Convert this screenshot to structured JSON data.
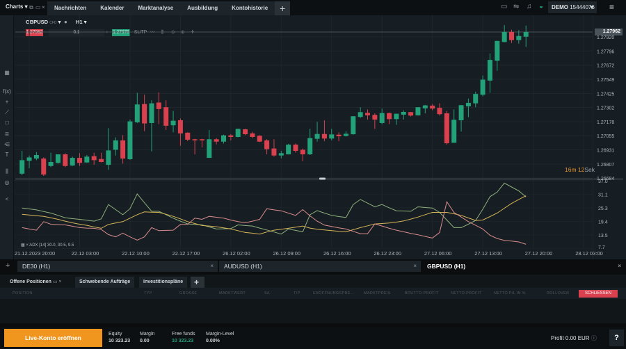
{
  "topbar": {
    "app_title": "Charts",
    "tabs": [
      "Nachrichten",
      "Kalender",
      "Marktanalyse",
      "Ausbildung",
      "Kontohistorie"
    ],
    "add_tab": "+",
    "account_mode": "DEMO",
    "account_number": "15444076"
  },
  "chart": {
    "symbol": "GBPUSD",
    "symbol_type": "CFD",
    "timeframe": "H1",
    "sell_price": "1.27962",
    "buy_price": "1.27978",
    "volume": "0.1",
    "minus": "−",
    "plus": "+",
    "sltp": "SL/TP",
    "current_price": "1.27962",
    "countdown_min": "16m",
    "countdown_sec": "12",
    "countdown_unit": "Sek",
    "indicator_legend": "ADX [14] 30.0, 30.5, 9.5"
  },
  "chart_data": [
    {
      "type": "candlestick",
      "title": "GBPUSD H1",
      "y_ticks": [
        "1.27920",
        "1.27796",
        "1.27672",
        "1.27549",
        "1.27425",
        "1.27302",
        "1.27178",
        "1.27055",
        "1.26931",
        "1.26807",
        "1.26684"
      ],
      "ylim": [
        1.26684,
        1.27962
      ],
      "x_ticks": [
        "21.12.2023 20:00",
        "22.12 03:00",
        "22.12 10:00",
        "22.12 17:00",
        "26.12 02:00",
        "26.12 09:00",
        "26.12 16:00",
        "26.12 23:00",
        "27.12 06:00",
        "27.12 13:00",
        "27.12 20:00",
        "28.12 03:00"
      ],
      "colors": {
        "up": "#23a27a",
        "down": "#d9414e"
      },
      "ohlc": [
        [
          1.26723,
          1.26922,
          1.26709,
          1.26841
        ],
        [
          1.26835,
          1.26882,
          1.2677,
          1.26865
        ],
        [
          1.26855,
          1.26912,
          1.26841,
          1.26886
        ],
        [
          1.26855,
          1.26865,
          1.26703,
          1.26715
        ],
        [
          1.2679,
          1.26906,
          1.2678,
          1.26825
        ],
        [
          1.26817,
          1.26892,
          1.26811,
          1.26892
        ],
        [
          1.26892,
          1.26902,
          1.2678,
          1.2679
        ],
        [
          1.26794,
          1.26872,
          1.2679,
          1.26861
        ],
        [
          1.26861,
          1.26902,
          1.2679,
          1.26817
        ],
        [
          1.26821,
          1.26886,
          1.26817,
          1.26872
        ],
        [
          1.26876,
          1.26906,
          1.268,
          1.26841
        ],
        [
          1.26851,
          1.26906,
          1.26821,
          1.26825
        ],
        [
          1.268,
          1.27121,
          1.26756,
          1.26926
        ],
        [
          1.26932,
          1.2704,
          1.26882,
          1.27014
        ],
        [
          1.27014,
          1.2706,
          1.26811,
          1.26855
        ],
        [
          1.26849,
          1.27196,
          1.26845,
          1.2718
        ],
        [
          1.27172,
          1.2743,
          1.27166,
          1.27328
        ],
        [
          1.27332,
          1.27414,
          1.27095,
          1.27162
        ],
        [
          1.27166,
          1.27365,
          1.26918,
          1.27338
        ],
        [
          1.27345,
          1.27434,
          1.27156,
          1.27288
        ],
        [
          1.27304,
          1.27365,
          1.27105,
          1.27142
        ],
        [
          1.27146,
          1.27271,
          1.27085,
          1.27186
        ],
        [
          1.2719,
          1.27206,
          1.26967,
          1.27075
        ],
        [
          1.27081,
          1.27085,
          1.27008,
          1.2702
        ],
        [
          1.27024,
          1.27028,
          1.26892,
          1.27014
        ],
        [
          1.27024,
          1.27028,
          1.26953,
          1.27014
        ],
        [
          1.26861,
          1.27105,
          1.26861,
          1.27024
        ],
        [
          1.27024,
          1.27034,
          1.26979,
          1.27003
        ],
        [
          1.27003,
          1.27064,
          1.26987,
          1.27058
        ],
        [
          1.27058,
          1.27068,
          1.27014,
          1.27044
        ],
        [
          1.27044,
          1.27115,
          1.2704,
          1.27115
        ],
        [
          1.27111,
          1.27115,
          1.2706,
          1.27068
        ],
        [
          1.27075,
          1.27089,
          1.27034,
          1.27044
        ],
        [
          1.27054,
          1.2706,
          1.26999,
          1.27003
        ],
        [
          1.27014,
          1.27024,
          1.26892,
          1.26937
        ],
        [
          1.26943,
          1.27024,
          1.26872,
          1.26882
        ],
        [
          1.26882,
          1.26922,
          1.26857,
          1.26902
        ],
        [
          1.26892,
          1.26983,
          1.2689,
          1.26977
        ],
        [
          1.26977,
          1.26987,
          1.26906,
          1.26922
        ],
        [
          1.26932,
          1.26943,
          1.26831,
          1.26892
        ],
        [
          1.26892,
          1.27115,
          1.26886,
          1.27034
        ],
        [
          1.27028,
          1.27176,
          1.27003,
          1.2707
        ],
        [
          1.2707,
          1.2719,
          1.27007,
          1.2703
        ],
        [
          1.2703,
          1.27115,
          1.27014,
          1.27066
        ],
        [
          1.27064,
          1.27085,
          1.27007,
          1.2705
        ],
        [
          1.27052,
          1.27095,
          1.27048,
          1.27072
        ],
        [
          1.27068,
          1.27225,
          1.27064,
          1.27225
        ],
        [
          1.27219,
          1.27304,
          1.2721,
          1.27261
        ],
        [
          1.27255,
          1.27284,
          1.27196,
          1.27233
        ],
        [
          1.27237,
          1.27251,
          1.27115,
          1.27196
        ],
        [
          1.27166,
          1.27292,
          1.27156,
          1.27253
        ],
        [
          1.27253,
          1.27257,
          1.27156,
          1.272
        ],
        [
          1.272,
          1.27247,
          1.2715,
          1.27247
        ],
        [
          1.27239,
          1.27277,
          1.27196,
          1.27263
        ],
        [
          1.27261,
          1.27263,
          1.27223,
          1.27231
        ],
        [
          1.27233,
          1.27304,
          1.27231,
          1.27304
        ],
        [
          1.27294,
          1.27324,
          1.27251,
          1.2732
        ],
        [
          1.27318,
          1.27332,
          1.27277,
          1.27292
        ],
        [
          1.27298,
          1.27338,
          1.27231,
          1.27243
        ],
        [
          1.27251,
          1.27271,
          1.26977,
          1.26989
        ],
        [
          1.26993,
          1.27284,
          1.26993,
          1.27194
        ],
        [
          1.2719,
          1.27322,
          1.27091,
          1.27322
        ],
        [
          1.27312,
          1.27379,
          1.27217,
          1.27342
        ],
        [
          1.27338,
          1.2744,
          1.27304,
          1.2742
        ],
        [
          1.27413,
          1.27582,
          1.27399,
          1.27545
        ],
        [
          1.27537,
          1.27775,
          1.2743,
          1.27718
        ],
        [
          1.2771,
          1.27884,
          1.27623,
          1.27884
        ],
        [
          1.27874,
          1.28022,
          1.27872,
          1.27962
        ],
        [
          1.27962,
          1.27982,
          1.27866,
          1.27891
        ],
        [
          1.27891,
          1.27978,
          1.2786,
          1.27927
        ],
        [
          1.27921,
          1.28018,
          1.27832,
          1.27962
        ]
      ]
    },
    {
      "type": "line",
      "title": "ADX [14]",
      "y_ticks": [
        "37.0",
        "31.1",
        "25.3",
        "19.4",
        "13.5",
        "7.7"
      ],
      "ylim": [
        7.7,
        37.0
      ],
      "series": [
        {
          "color": "#8fb07c",
          "values": [
            25.2,
            24.8,
            24.4,
            23.7,
            23.0,
            22.0,
            21.0,
            20.6,
            20.3,
            19.9,
            19.5,
            20.5,
            26.7,
            24.5,
            22.3,
            24.9,
            31.3,
            27.5,
            23.8,
            23.8,
            22.3,
            20.8,
            19.5,
            18.3,
            18.1,
            17.9,
            17.0,
            16.1,
            16.2,
            16.3,
            17.9,
            17.6,
            17.4,
            16.5,
            15.7,
            14.8,
            13.9,
            16.1,
            15.5,
            14.9,
            22.3,
            24.1,
            23.0,
            22.0,
            21.5,
            21.1,
            26.7,
            28.9,
            27.3,
            25.7,
            26.7,
            25.3,
            24.0,
            23.9,
            23.8,
            25.7,
            25.4,
            25.2,
            23.3,
            20.0,
            16.7,
            16.7,
            18.2,
            19.8,
            24.7,
            30.1,
            32.1,
            36.0,
            34.3,
            32.6,
            30.0
          ]
        },
        {
          "color": "#d6b656",
          "values": [
            22.5,
            22.2,
            21.9,
            21.6,
            21.0,
            20.3,
            19.5,
            18.8,
            18.2,
            17.7,
            17.0,
            16.4,
            18.1,
            18.7,
            19.3,
            20.8,
            22.3,
            23.5,
            23.4,
            23.3,
            22.5,
            21.6,
            20.5,
            19.3,
            18.5,
            17.6,
            17.4,
            17.1,
            16.6,
            16.1,
            15.4,
            14.6,
            14.3,
            13.9,
            14.8,
            15.6,
            16.0,
            16.4,
            16.9,
            17.4,
            16.5,
            16.0,
            15.7,
            15.4,
            15.1,
            14.9,
            15.8,
            16.7,
            17.5,
            18.3,
            18.5,
            18.7,
            19.1,
            19.6,
            20.4,
            21.3,
            22.3,
            23.3,
            23.3,
            23.3,
            22.7,
            22.0,
            20.9,
            19.8,
            20.0,
            21.5,
            23.0,
            25.1,
            27.2,
            28.9,
            30.5
          ]
        },
        {
          "color": "#d98c8c",
          "values": [
            16.7,
            16.1,
            15.6,
            19.3,
            18.2,
            18.0,
            17.9,
            17.3,
            16.7,
            16.5,
            16.4,
            15.9,
            13.7,
            12.7,
            14.3,
            12.7,
            11.3,
            12.7,
            16.7,
            15.4,
            15.5,
            15.6,
            18.1,
            18.1,
            20.8,
            20.3,
            21.6,
            21.2,
            20.8,
            20.0,
            19.3,
            18.8,
            19.5,
            20.3,
            24.9,
            24.4,
            24.0,
            23.0,
            22.0,
            24.5,
            21.8,
            19.5,
            17.8,
            17.2,
            16.6,
            16.1,
            15.1,
            14.1,
            14.1,
            18.3,
            17.4,
            16.4,
            15.6,
            14.9,
            14.2,
            13.6,
            12.9,
            12.2,
            14.6,
            27.9,
            23.3,
            21.3,
            19.3,
            17.7,
            16.1,
            13.4,
            12.0,
            11.2,
            10.9,
            10.5,
            9.5
          ]
        }
      ]
    }
  ],
  "instrument_tabs": [
    {
      "label": "DE30 (H1)",
      "active": false
    },
    {
      "label": "AUDUSD (H1)",
      "active": false
    },
    {
      "label": "GBPUSD (H1)",
      "active": true
    }
  ],
  "positions": {
    "tabs": [
      "Offene Positionen",
      "Schwebende Aufträge",
      "Investitionspläne"
    ],
    "columns": [
      "POSITION",
      "TYP",
      "GRÖSSE",
      "MARKTWERT",
      "S/L",
      "T/P",
      "ERÖFFNUNGSPRE...",
      "MARKTPREIS",
      "BRUTTO-PROFIT",
      "NETTO-PROFIT",
      "NETTO P/L IN %",
      "ROLLOVER"
    ],
    "close_all": "SCHLIESSEN"
  },
  "footer": {
    "live_button": "Live-Konto eröffnen",
    "equity_label": "Equity",
    "equity": "10 323.23",
    "margin_label": "Margin",
    "margin": "0.00",
    "free_label": "Free funds",
    "free": "10 323.23",
    "level_label": "Margin-Level",
    "level": "0.00%",
    "profit": "Profit 0.00 EUR",
    "help": "?"
  }
}
